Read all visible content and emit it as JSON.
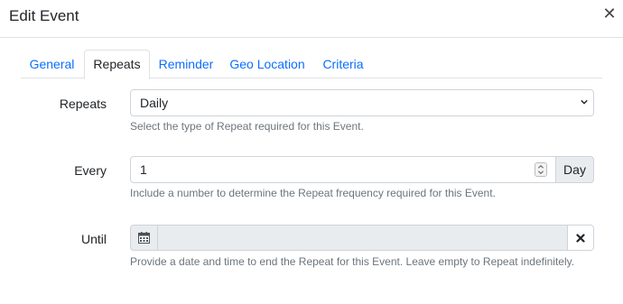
{
  "modal": {
    "title": "Edit Event",
    "close_icon": "close-icon"
  },
  "tabs": [
    {
      "label": "General",
      "active": false
    },
    {
      "label": "Repeats",
      "active": true
    },
    {
      "label": "Reminder",
      "active": false
    },
    {
      "label": "Geo Location",
      "active": false
    },
    {
      "label": "Criteria",
      "active": false
    }
  ],
  "form": {
    "repeats": {
      "label": "Repeats",
      "value": "Daily",
      "help": "Select the type of Repeat required for this Event."
    },
    "every": {
      "label": "Every",
      "value": "1",
      "unit": "Day",
      "help": "Include a number to determine the Repeat frequency required for this Event."
    },
    "until": {
      "label": "Until",
      "value": "",
      "calendar_icon": "calendar-icon",
      "clear_icon": "clear-icon",
      "help": "Provide a date and time to end the Repeat for this Event. Leave empty to Repeat indefinitely."
    }
  },
  "colors": {
    "link": "#0d6efd",
    "muted": "#6c757d",
    "border": "#ced4da",
    "disabled_bg": "#e9ecef"
  }
}
